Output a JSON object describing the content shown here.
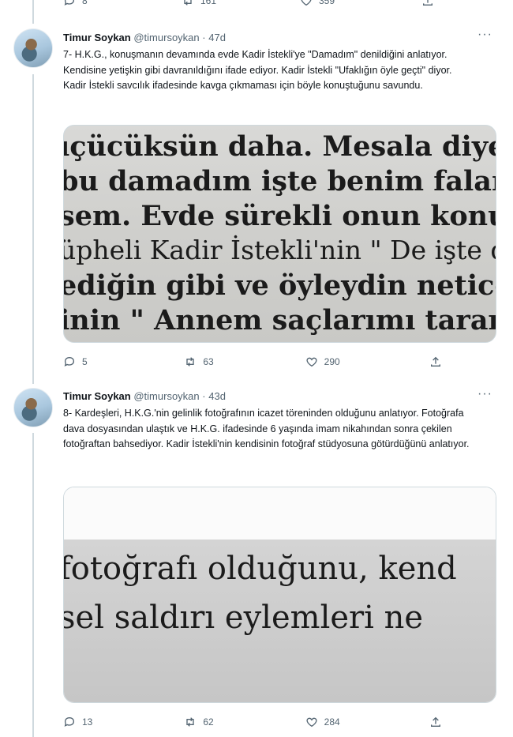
{
  "previous_tweet_actions": {
    "replies": "8",
    "retweets": "161",
    "likes": "359"
  },
  "tweets": [
    {
      "author": {
        "name": "Timur Soykan",
        "handle": "@timursoykan"
      },
      "separator": "·",
      "time": "47d",
      "text": "7- H.K.G., konuşmanın devamında evde Kadir İstekli'ye \"Damadım\" denildiğini anlatıyor. Kendisine yetişkin gibi davranıldığını ifade ediyor. Kadir İstekli \"Ufaklığın öyle geçti\" diyor. Kadir İstekli savcılık ifadesinde kavga çıkmaması için böyle konuştuğunu savundu.",
      "image_lines": [
        "ıçücüksün daha. Mesala diyelin",
        "bu damadım işte benim falan. Y",
        "sem. Evde sürekli onun konusu",
        "üpheli Kadir İstekli'nin \" De işte de",
        "ediğin gibi ve öyleydin neticede",
        "inin \" Annem saçlarımı tarar seni"
      ],
      "replies": "5",
      "retweets": "63",
      "likes": "290"
    },
    {
      "author": {
        "name": "Timur Soykan",
        "handle": "@timursoykan"
      },
      "separator": "·",
      "time": "43d",
      "text": "8- Kardeşleri, H.K.G.'nin gelinlik fotoğrafının icazet töreninden olduğunu anlatıyor. Fotoğrafa dava dosyasından ulaştık ve H.K.G. ifadesinde 6 yaşında imam nikahından sonra çekilen fotoğraftan bahsediyor. Kadir İstekli'nin kendisinin fotoğraf stüdyosuna götürdüğünü anlatıyor.",
      "image_lines": [
        "fotoğrafı olduğunu, kend",
        "sel saldırı eylemleri ne"
      ],
      "replies": "13",
      "retweets": "62",
      "likes": "284"
    }
  ],
  "colors": {
    "text": "#0f1419",
    "secondary": "#536471",
    "border": "#cfd9de"
  },
  "icons": [
    "reply-icon",
    "retweet-icon",
    "like-icon",
    "share-icon",
    "more-icon"
  ]
}
